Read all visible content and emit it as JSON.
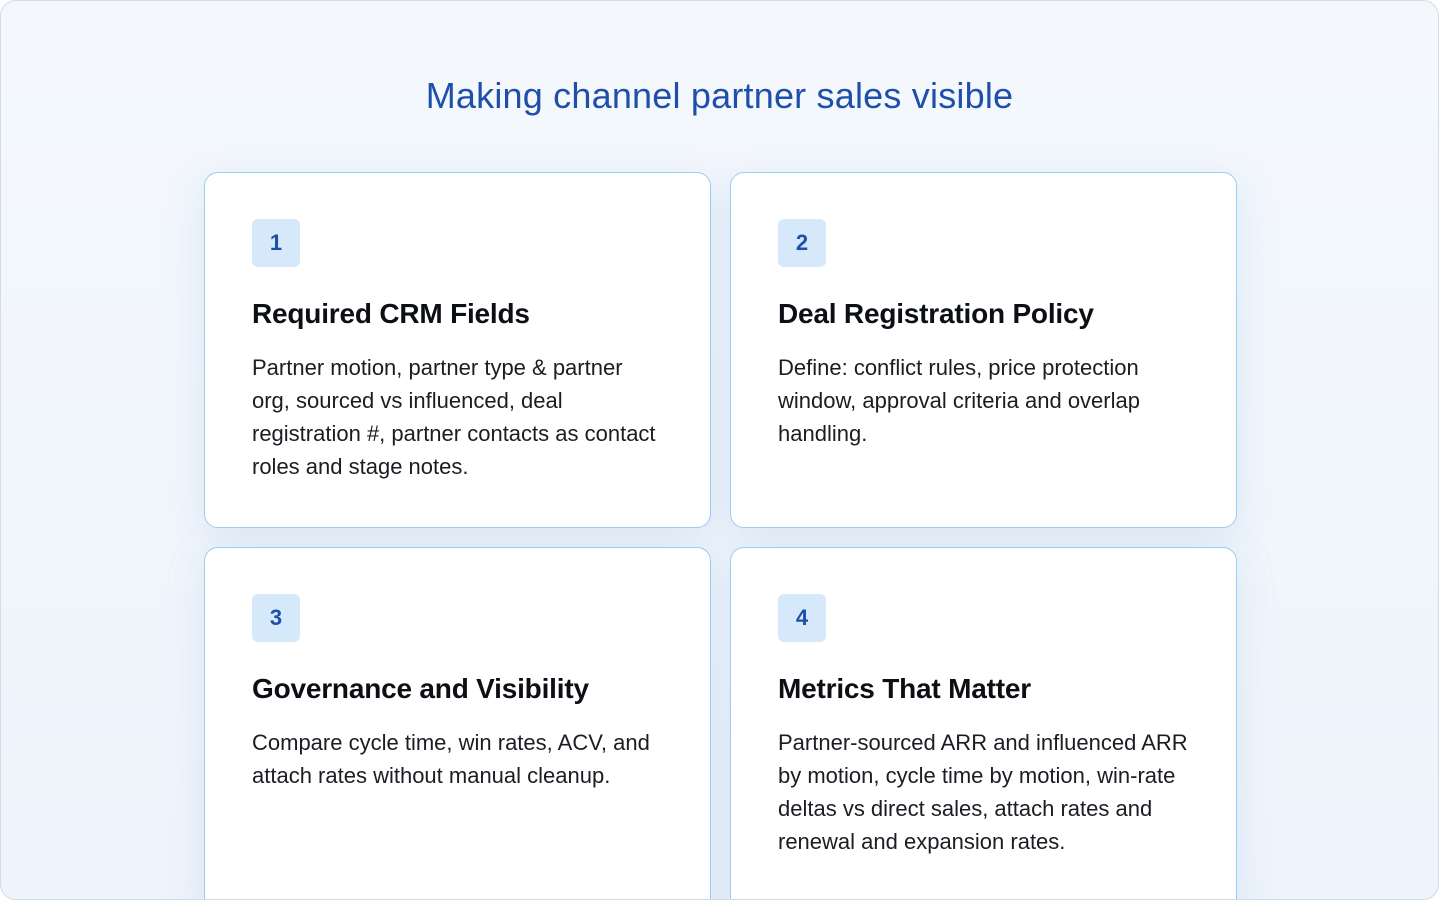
{
  "header": {
    "title": "Making channel partner sales visible"
  },
  "cards": [
    {
      "number": "1",
      "title": "Required CRM Fields",
      "description": "Partner motion, partner type & partner org, sourced vs influenced, deal registration #, partner contacts as contact roles and stage notes."
    },
    {
      "number": "2",
      "title": "Deal Registration Policy",
      "description": "Define: conflict rules, price protection window, approval criteria and overlap handling."
    },
    {
      "number": "3",
      "title": "Governance and Visibility",
      "description": "Compare cycle time, win rates, ACV, and attach rates without manual cleanup."
    },
    {
      "number": "4",
      "title": "Metrics That Matter",
      "description": "Partner-sourced ARR and influenced ARR by motion, cycle time by motion, win-rate deltas vs direct sales, attach rates and renewal and expansion rates."
    }
  ],
  "colors": {
    "accent": "#1f4fa8",
    "badge_bg": "#d6e9fb",
    "card_border": "#9dccf2",
    "page_bg": "#f4f8fd"
  }
}
